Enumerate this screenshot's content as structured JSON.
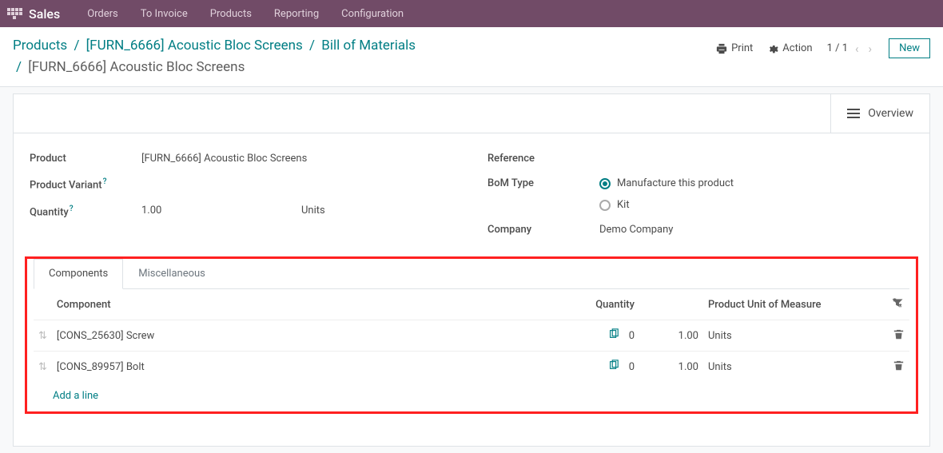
{
  "navbar": {
    "brand": "Sales",
    "items": [
      "Orders",
      "To Invoice",
      "Products",
      "Reporting",
      "Configuration"
    ]
  },
  "breadcrumb": {
    "products": "Products",
    "product": "[FURN_6666] Acoustic Bloc Screens",
    "bom": "Bill of Materials",
    "current": "[FURN_6666] Acoustic Bloc Screens"
  },
  "actions": {
    "print": "Print",
    "action": "Action",
    "pager": "1 / 1",
    "new": "New",
    "overview": "Overview"
  },
  "form": {
    "product_label": "Product",
    "product_value": "[FURN_6666] Acoustic Bloc Screens",
    "variant_label": "Product Variant",
    "quantity_label": "Quantity",
    "quantity_value": "1.00",
    "quantity_unit": "Units",
    "reference_label": "Reference",
    "bom_type_label": "BoM Type",
    "bom_type_opt1": "Manufacture this product",
    "bom_type_opt2": "Kit",
    "company_label": "Company",
    "company_value": "Demo Company"
  },
  "tabs": {
    "components": "Components",
    "misc": "Miscellaneous"
  },
  "table": {
    "col_component": "Component",
    "col_quantity": "Quantity",
    "col_uom": "Product Unit of Measure",
    "rows": [
      {
        "name": "[CONS_25630] Screw",
        "zero": "0",
        "qty": "1.00",
        "uom": "Units"
      },
      {
        "name": "[CONS_89957] Bolt",
        "zero": "0",
        "qty": "1.00",
        "uom": "Units"
      }
    ],
    "add_line": "Add a line"
  }
}
